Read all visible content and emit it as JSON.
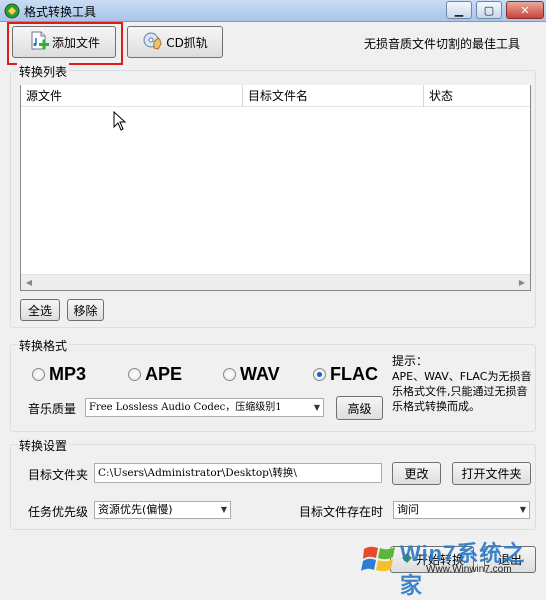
{
  "window": {
    "title": "格式转换工具",
    "controls": {
      "minimize": "▁",
      "maximize": "▢",
      "close": "✕"
    }
  },
  "toolbar": {
    "add_file_label": "添加文件",
    "cd_rip_label": "CD抓轨",
    "tagline": "无损音质文件切割的最佳工具"
  },
  "file_list": {
    "group_title": "转换列表",
    "columns": [
      "源文件",
      "目标文件名",
      "状态"
    ],
    "rows": []
  },
  "list_actions": {
    "select_all_label": "全选",
    "remove_label": "移除"
  },
  "format": {
    "group_title": "转换格式",
    "options": [
      {
        "label": "MP3",
        "checked": false
      },
      {
        "label": "APE",
        "checked": false
      },
      {
        "label": "WAV",
        "checked": false
      },
      {
        "label": "FLAC",
        "checked": true
      }
    ],
    "hint_title": "提示：",
    "hint_text": "APE、WAV、FLAC为无损音乐格式文件,只能通过无损音乐格式转换而成。",
    "quality_label": "音乐质量",
    "quality_value": "Free Lossless Audio Codec，压缩级别1",
    "advanced_label": "高级"
  },
  "settings": {
    "group_title": "转换设置",
    "target_folder_label": "目标文件夹",
    "target_folder_value": "C:\\Users\\Administrator\\Desktop\\转换\\",
    "change_label": "更改",
    "open_folder_label": "打开文件夹",
    "priority_label": "任务优先级",
    "priority_value": "资源优先(偏慢)",
    "exists_label": "目标文件存在时",
    "exists_value": "询问"
  },
  "footer": {
    "start_label": "开始转换",
    "exit_label": "退出"
  },
  "watermark": {
    "brand": "Win7系统之家",
    "url": "Www.Winwin7.com"
  }
}
